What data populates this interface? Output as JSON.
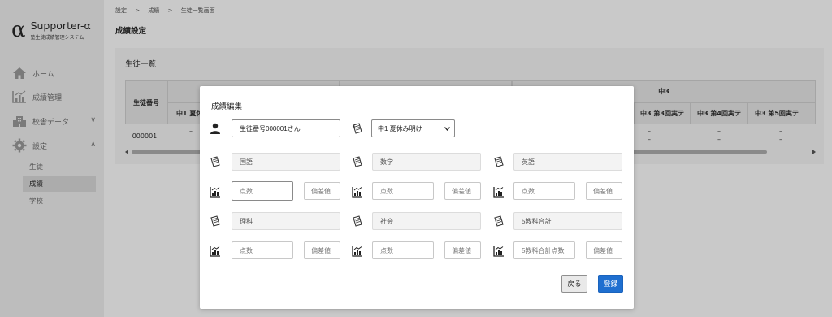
{
  "app": {
    "logo_symbol": "α",
    "title": "Supporter-α",
    "subtitle": "塾生徒成績管理システム"
  },
  "sidebar": {
    "items": [
      {
        "label": "ホーム",
        "icon": "home-icon"
      },
      {
        "label": "成績管理",
        "icon": "chart-icon"
      },
      {
        "label": "校舎データ",
        "icon": "building-icon"
      },
      {
        "label": "設定",
        "icon": "gear-icon"
      }
    ],
    "sub_items": [
      {
        "label": "生徒"
      },
      {
        "label": "成績"
      },
      {
        "label": "学校"
      }
    ],
    "chevron_down": "∨",
    "chevron_up": "∧"
  },
  "breadcrumb": {
    "items": [
      "設定",
      "成績",
      "生徒一覧画面"
    ],
    "separator": ">"
  },
  "page": {
    "title": "成績設定",
    "card_title": "生徒一覧"
  },
  "table": {
    "student_number_header": "生徒番号",
    "group_header": "中3",
    "sub_headers": [
      "中1 夏休",
      "中3 第3回実テ",
      "中3 第4回実テ",
      "中3 第5回実テ"
    ],
    "row": {
      "student_number": "000001",
      "dash": "–"
    }
  },
  "modal": {
    "title": "成績編集",
    "student_name": "生徒番号000001さん",
    "exam_select": "中1 夏休み明け",
    "subjects": [
      "国語",
      "数学",
      "英語",
      "理科",
      "社会",
      "5教科合計"
    ],
    "score_placeholders": [
      "点数",
      "点数",
      "点数",
      "点数",
      "点数",
      "5教科合計点数"
    ],
    "deviation_placeholder": "偏差値",
    "back_label": "戻る",
    "register_label": "登録"
  },
  "colors": {
    "primary": "#1f6fd0",
    "sidebar_bg": "#bdbdbd",
    "overlay_bg": "#c9c9c9"
  }
}
